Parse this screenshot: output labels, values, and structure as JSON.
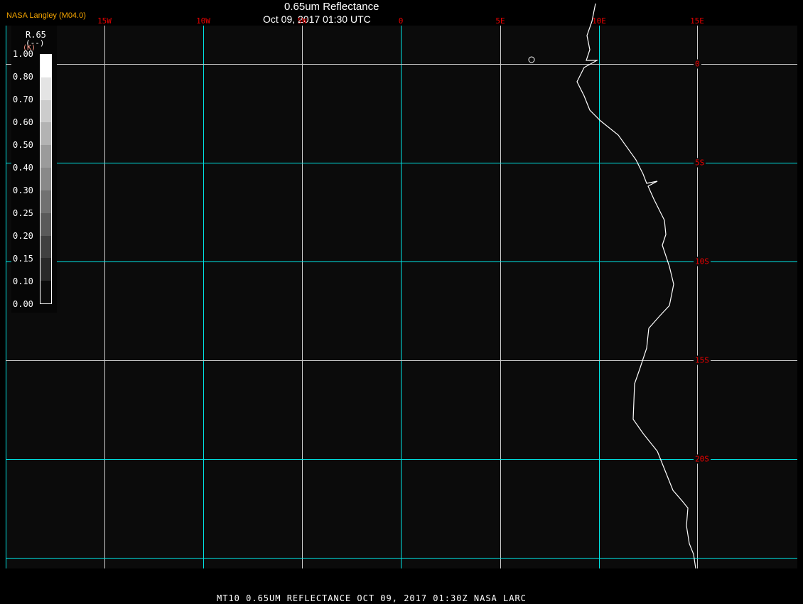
{
  "header": {
    "title": "0.65um Reflectance",
    "datetime": "Oct 09, 2017 01:30 UTC",
    "organization": "NASA Langley (M04.0)"
  },
  "footer": {
    "caption": "MT10  0.65UM REFLECTANCE   OCT 09, 2017 01:30Z   NASA LARC"
  },
  "map": {
    "longitude_labels": [
      "15W",
      "10W",
      "5W",
      "0",
      "5E",
      "10E",
      "15E"
    ],
    "latitude_labels": [
      "0",
      "5S",
      "10S",
      "15S",
      "20S"
    ],
    "colors": {
      "background": "#0b0b0b",
      "grid_major": "#00e5e5",
      "grid_minor": "#cccccc",
      "coastline": "#ffffff",
      "grid_labels": "#ee0000"
    }
  },
  "legend": {
    "variable": "R.65",
    "unit": "(--)",
    "unit_extra": "(K)",
    "levels": [
      "1.00",
      "0.80",
      "0.70",
      "0.60",
      "0.50",
      "0.40",
      "0.30",
      "0.25",
      "0.20",
      "0.15",
      "0.10",
      "0.00"
    ],
    "colors": [
      "#ffffff",
      "#e4e4e4",
      "#cccccc",
      "#b3b3b3",
      "#9b9b9b",
      "#898989",
      "#717171",
      "#5a5a5a",
      "#404040",
      "#2a2a2a",
      "#0b0b0b"
    ]
  }
}
